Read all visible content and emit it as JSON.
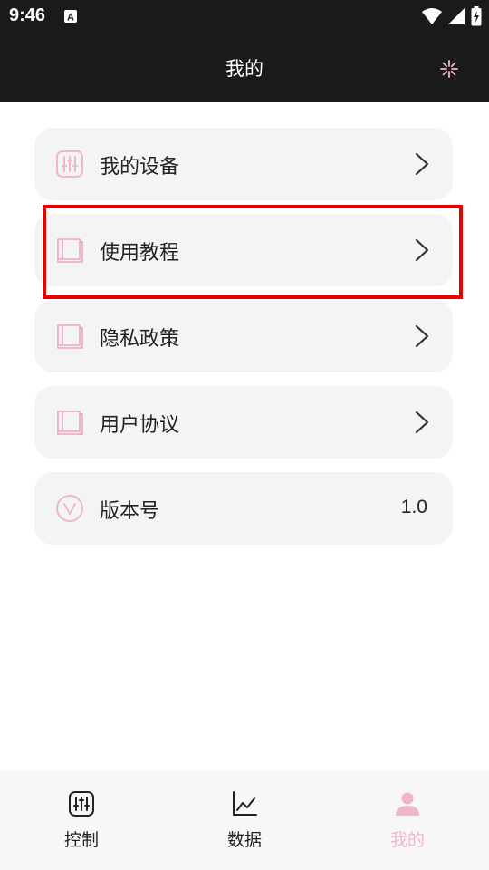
{
  "status_bar": {
    "time": "9:46",
    "icons": [
      "sim-a-icon",
      "wifi-icon",
      "signal-icon",
      "battery-charging-icon"
    ]
  },
  "header": {
    "title": "我的",
    "settings_icon": "settings-sparkle-icon"
  },
  "menu": {
    "items": [
      {
        "label": "我的设备",
        "icon": "sliders-icon",
        "has_chevron": true
      },
      {
        "label": "使用教程",
        "icon": "book-icon",
        "has_chevron": true,
        "highlighted": true
      },
      {
        "label": "隐私政策",
        "icon": "book-icon",
        "has_chevron": true
      },
      {
        "label": "用户协议",
        "icon": "book-icon",
        "has_chevron": true
      },
      {
        "label": "版本号",
        "icon": "version-v-icon",
        "value": "1.0"
      }
    ]
  },
  "bottom_nav": {
    "tabs": [
      {
        "label": "控制",
        "icon": "control-sliders-icon",
        "active": false
      },
      {
        "label": "数据",
        "icon": "chart-icon",
        "active": false
      },
      {
        "label": "我的",
        "icon": "user-icon",
        "active": true
      }
    ]
  },
  "colors": {
    "header_bg": "#1a1a1a",
    "accent_pink": "#f2b6cc",
    "card_bg": "#f4f4f4",
    "highlight_red": "#e80000"
  }
}
